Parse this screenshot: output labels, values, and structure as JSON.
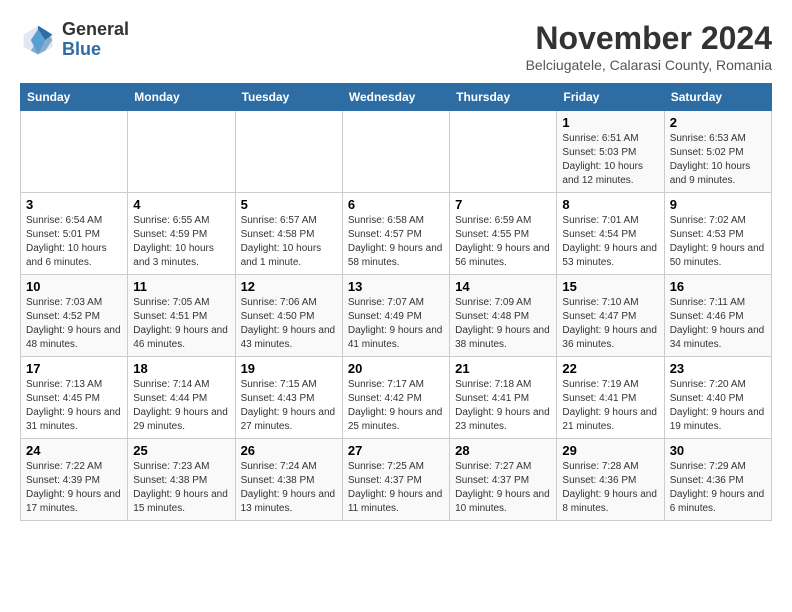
{
  "header": {
    "logo_line1": "General",
    "logo_line2": "Blue",
    "month": "November 2024",
    "location": "Belciugatele, Calarasi County, Romania"
  },
  "weekdays": [
    "Sunday",
    "Monday",
    "Tuesday",
    "Wednesday",
    "Thursday",
    "Friday",
    "Saturday"
  ],
  "weeks": [
    [
      {
        "day": "",
        "info": ""
      },
      {
        "day": "",
        "info": ""
      },
      {
        "day": "",
        "info": ""
      },
      {
        "day": "",
        "info": ""
      },
      {
        "day": "",
        "info": ""
      },
      {
        "day": "1",
        "info": "Sunrise: 6:51 AM\nSunset: 5:03 PM\nDaylight: 10 hours and 12 minutes."
      },
      {
        "day": "2",
        "info": "Sunrise: 6:53 AM\nSunset: 5:02 PM\nDaylight: 10 hours and 9 minutes."
      }
    ],
    [
      {
        "day": "3",
        "info": "Sunrise: 6:54 AM\nSunset: 5:01 PM\nDaylight: 10 hours and 6 minutes."
      },
      {
        "day": "4",
        "info": "Sunrise: 6:55 AM\nSunset: 4:59 PM\nDaylight: 10 hours and 3 minutes."
      },
      {
        "day": "5",
        "info": "Sunrise: 6:57 AM\nSunset: 4:58 PM\nDaylight: 10 hours and 1 minute."
      },
      {
        "day": "6",
        "info": "Sunrise: 6:58 AM\nSunset: 4:57 PM\nDaylight: 9 hours and 58 minutes."
      },
      {
        "day": "7",
        "info": "Sunrise: 6:59 AM\nSunset: 4:55 PM\nDaylight: 9 hours and 56 minutes."
      },
      {
        "day": "8",
        "info": "Sunrise: 7:01 AM\nSunset: 4:54 PM\nDaylight: 9 hours and 53 minutes."
      },
      {
        "day": "9",
        "info": "Sunrise: 7:02 AM\nSunset: 4:53 PM\nDaylight: 9 hours and 50 minutes."
      }
    ],
    [
      {
        "day": "10",
        "info": "Sunrise: 7:03 AM\nSunset: 4:52 PM\nDaylight: 9 hours and 48 minutes."
      },
      {
        "day": "11",
        "info": "Sunrise: 7:05 AM\nSunset: 4:51 PM\nDaylight: 9 hours and 46 minutes."
      },
      {
        "day": "12",
        "info": "Sunrise: 7:06 AM\nSunset: 4:50 PM\nDaylight: 9 hours and 43 minutes."
      },
      {
        "day": "13",
        "info": "Sunrise: 7:07 AM\nSunset: 4:49 PM\nDaylight: 9 hours and 41 minutes."
      },
      {
        "day": "14",
        "info": "Sunrise: 7:09 AM\nSunset: 4:48 PM\nDaylight: 9 hours and 38 minutes."
      },
      {
        "day": "15",
        "info": "Sunrise: 7:10 AM\nSunset: 4:47 PM\nDaylight: 9 hours and 36 minutes."
      },
      {
        "day": "16",
        "info": "Sunrise: 7:11 AM\nSunset: 4:46 PM\nDaylight: 9 hours and 34 minutes."
      }
    ],
    [
      {
        "day": "17",
        "info": "Sunrise: 7:13 AM\nSunset: 4:45 PM\nDaylight: 9 hours and 31 minutes."
      },
      {
        "day": "18",
        "info": "Sunrise: 7:14 AM\nSunset: 4:44 PM\nDaylight: 9 hours and 29 minutes."
      },
      {
        "day": "19",
        "info": "Sunrise: 7:15 AM\nSunset: 4:43 PM\nDaylight: 9 hours and 27 minutes."
      },
      {
        "day": "20",
        "info": "Sunrise: 7:17 AM\nSunset: 4:42 PM\nDaylight: 9 hours and 25 minutes."
      },
      {
        "day": "21",
        "info": "Sunrise: 7:18 AM\nSunset: 4:41 PM\nDaylight: 9 hours and 23 minutes."
      },
      {
        "day": "22",
        "info": "Sunrise: 7:19 AM\nSunset: 4:41 PM\nDaylight: 9 hours and 21 minutes."
      },
      {
        "day": "23",
        "info": "Sunrise: 7:20 AM\nSunset: 4:40 PM\nDaylight: 9 hours and 19 minutes."
      }
    ],
    [
      {
        "day": "24",
        "info": "Sunrise: 7:22 AM\nSunset: 4:39 PM\nDaylight: 9 hours and 17 minutes."
      },
      {
        "day": "25",
        "info": "Sunrise: 7:23 AM\nSunset: 4:38 PM\nDaylight: 9 hours and 15 minutes."
      },
      {
        "day": "26",
        "info": "Sunrise: 7:24 AM\nSunset: 4:38 PM\nDaylight: 9 hours and 13 minutes."
      },
      {
        "day": "27",
        "info": "Sunrise: 7:25 AM\nSunset: 4:37 PM\nDaylight: 9 hours and 11 minutes."
      },
      {
        "day": "28",
        "info": "Sunrise: 7:27 AM\nSunset: 4:37 PM\nDaylight: 9 hours and 10 minutes."
      },
      {
        "day": "29",
        "info": "Sunrise: 7:28 AM\nSunset: 4:36 PM\nDaylight: 9 hours and 8 minutes."
      },
      {
        "day": "30",
        "info": "Sunrise: 7:29 AM\nSunset: 4:36 PM\nDaylight: 9 hours and 6 minutes."
      }
    ]
  ]
}
